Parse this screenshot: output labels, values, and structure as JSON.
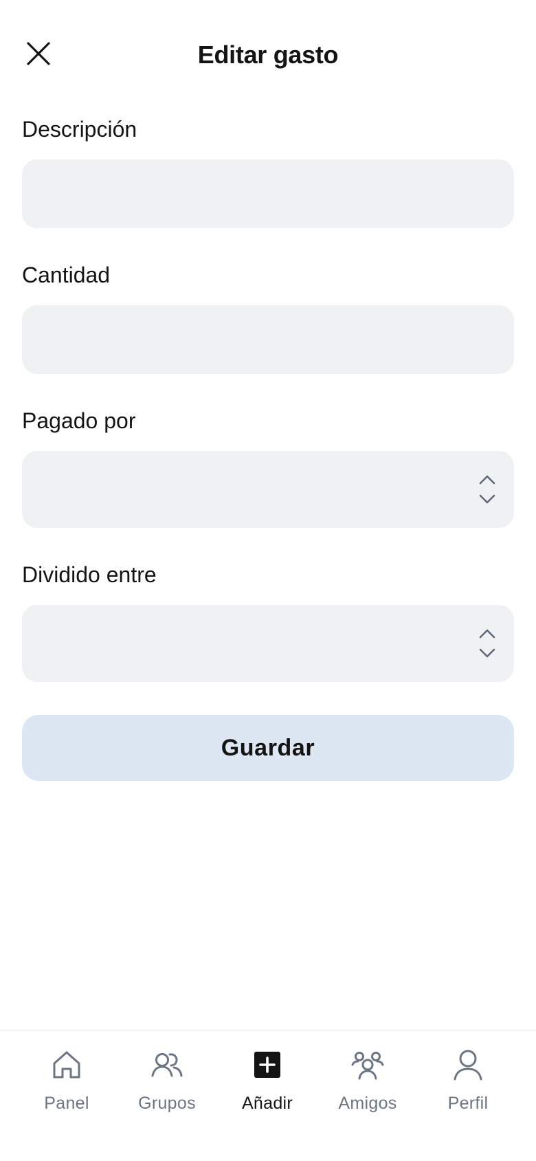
{
  "header": {
    "title": "Editar gasto",
    "close_icon": "close-icon"
  },
  "form": {
    "description": {
      "label": "Descripción",
      "value": ""
    },
    "amount": {
      "label": "Cantidad",
      "value": ""
    },
    "paid_by": {
      "label": "Pagado por",
      "value": ""
    },
    "split_between": {
      "label": "Dividido entre",
      "value": ""
    },
    "save_label": "Guardar"
  },
  "nav": {
    "items": [
      {
        "label": "Panel",
        "icon": "home-icon",
        "active": false
      },
      {
        "label": "Grupos",
        "icon": "groups-icon",
        "active": false
      },
      {
        "label": "Añadir",
        "icon": "add-square-icon",
        "active": true
      },
      {
        "label": "Amigos",
        "icon": "friends-icon",
        "active": false
      },
      {
        "label": "Perfil",
        "icon": "profile-icon",
        "active": false
      }
    ]
  },
  "colors": {
    "field_background": "#f0f1f3",
    "save_button_background": "#dce7f3",
    "nav_inactive": "#6b7682",
    "nav_active": "#141414"
  }
}
